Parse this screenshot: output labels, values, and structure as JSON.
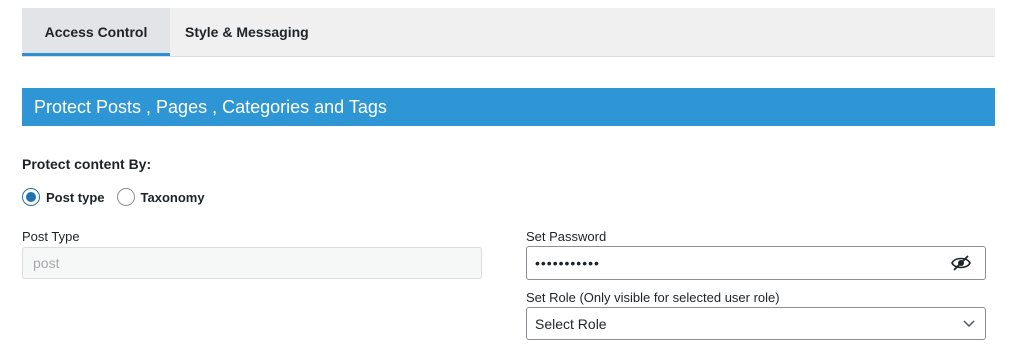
{
  "tabs": [
    {
      "label": "Access Control",
      "active": true
    },
    {
      "label": "Style & Messaging",
      "active": false
    }
  ],
  "banner": {
    "title": "Protect Posts , Pages , Categories and Tags",
    "color": "#2e96d5"
  },
  "protect_by": {
    "label": "Protect content By:",
    "options": [
      {
        "label": "Post type",
        "checked": true
      },
      {
        "label": "Taxonomy",
        "checked": false
      }
    ]
  },
  "post_type": {
    "label": "Post Type",
    "placeholder": "post",
    "value": ""
  },
  "password": {
    "label": "Set Password",
    "value": "•••••••••••",
    "icon": "eye-slash-icon"
  },
  "role": {
    "label": "Set Role (Only visible for selected user role)",
    "selected": "Select Role",
    "icon": "chevron-down-icon"
  },
  "colors": {
    "accent": "#2271b1",
    "tab_underline": "#2e8fd0"
  }
}
